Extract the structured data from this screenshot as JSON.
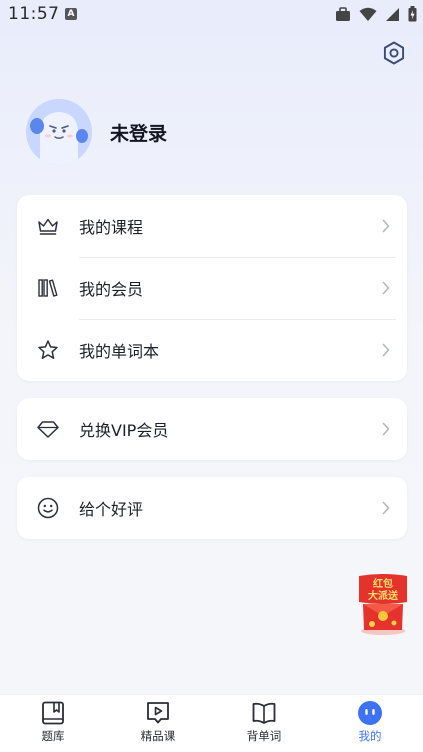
{
  "status_bar": {
    "time": "11:57",
    "notif_letter": "A"
  },
  "profile": {
    "name": "未登录"
  },
  "menu_group1": [
    {
      "label": "我的课程",
      "icon": "crown-icon"
    },
    {
      "label": "我的会员",
      "icon": "library-icon"
    },
    {
      "label": "我的单词本",
      "icon": "star-icon"
    }
  ],
  "menu_group2": [
    {
      "label": "兑换VIP会员",
      "icon": "diamond-icon"
    }
  ],
  "menu_group3": [
    {
      "label": "给个好评",
      "icon": "smile-icon"
    }
  ],
  "promo": {
    "line1": "红包",
    "line2": "大派送"
  },
  "tabs": [
    {
      "label": "题库",
      "icon": "bookmark-book-icon",
      "active": false
    },
    {
      "label": "精品课",
      "icon": "video-play-icon",
      "active": false
    },
    {
      "label": "背单词",
      "icon": "open-book-icon",
      "active": false
    },
    {
      "label": "我的",
      "icon": "profile-face-icon",
      "active": true
    }
  ],
  "colors": {
    "accent": "#3d73f2",
    "promo_red": "#e5322d"
  }
}
